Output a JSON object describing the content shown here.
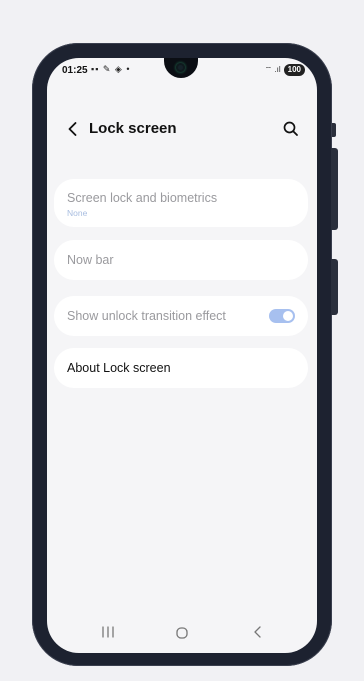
{
  "status_bar": {
    "time": "01:25",
    "left_icons": "▪▪ ✎ ◈ •",
    "right_icons": "⌔ .ıl",
    "battery": "100"
  },
  "header": {
    "title": "Lock screen",
    "back_icon": "back-arrow-icon",
    "search_icon": "search-icon"
  },
  "settings": [
    {
      "label": "Screen lock and biometrics",
      "sublabel": "None",
      "enabled": false
    },
    {
      "label": "Now bar",
      "enabled": false
    },
    {
      "label": "Show unlock transition effect",
      "enabled": false,
      "toggle_on": true
    },
    {
      "label": "About Lock screen",
      "enabled": true
    }
  ],
  "nav": {
    "recents_icon": "recents-icon",
    "home_icon": "home-icon",
    "back_icon": "back-icon"
  },
  "colors": {
    "accent": "#a7c0ef",
    "card": "#ffffff",
    "screen_bg": "#f5f5f7",
    "phone_frame": "#1d2230"
  }
}
